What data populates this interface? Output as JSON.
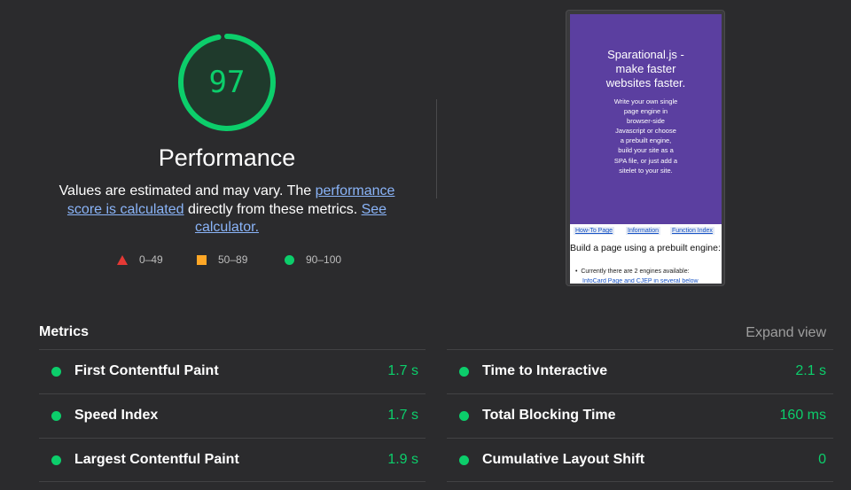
{
  "summary": {
    "score": "97",
    "score_fraction": 0.97,
    "title": "Performance",
    "desc_before": "Values are estimated and may vary. The ",
    "desc_link1": "performance score is calculated",
    "desc_middle": " directly from these metrics. ",
    "desc_link2": "See calculator.",
    "legend": [
      {
        "icon": "triangle-icon",
        "label": "0–49",
        "color": "#e53935"
      },
      {
        "icon": "square-icon",
        "label": "50–89",
        "color": "#ffa726"
      },
      {
        "icon": "circle-icon",
        "label": "90–100",
        "color": "#0cce6b"
      }
    ]
  },
  "screenshot": {
    "hero_title": "Sparational.js - make faster websites faster.",
    "hero_text": "Write your own single page engine in browser-side Javascript or choose a prebuilt engine, build your site as a SPA file, or just add a sitelet to your site.",
    "nav": [
      "How-To Page",
      "Information",
      "Function Index"
    ],
    "heading": "Build a page using a prebuilt engine:",
    "list_item": "Currently there are 2 engines available:",
    "list_links": "InfoCard Page and CJEP in several below"
  },
  "metrics": {
    "title": "Metrics",
    "expand_label": "Expand view",
    "items": [
      {
        "name": "First Contentful Paint",
        "value": "1.7 s"
      },
      {
        "name": "Time to Interactive",
        "value": "2.1 s"
      },
      {
        "name": "Speed Index",
        "value": "1.7 s"
      },
      {
        "name": "Total Blocking Time",
        "value": "160 ms"
      },
      {
        "name": "Largest Contentful Paint",
        "value": "1.9 s"
      },
      {
        "name": "Cumulative Layout Shift",
        "value": "0"
      }
    ]
  },
  "colors": {
    "background": "#2b2b2d",
    "pass": "#0cce6b",
    "link": "#8ab4f8",
    "screenshot_hero": "#5b3fa0"
  }
}
